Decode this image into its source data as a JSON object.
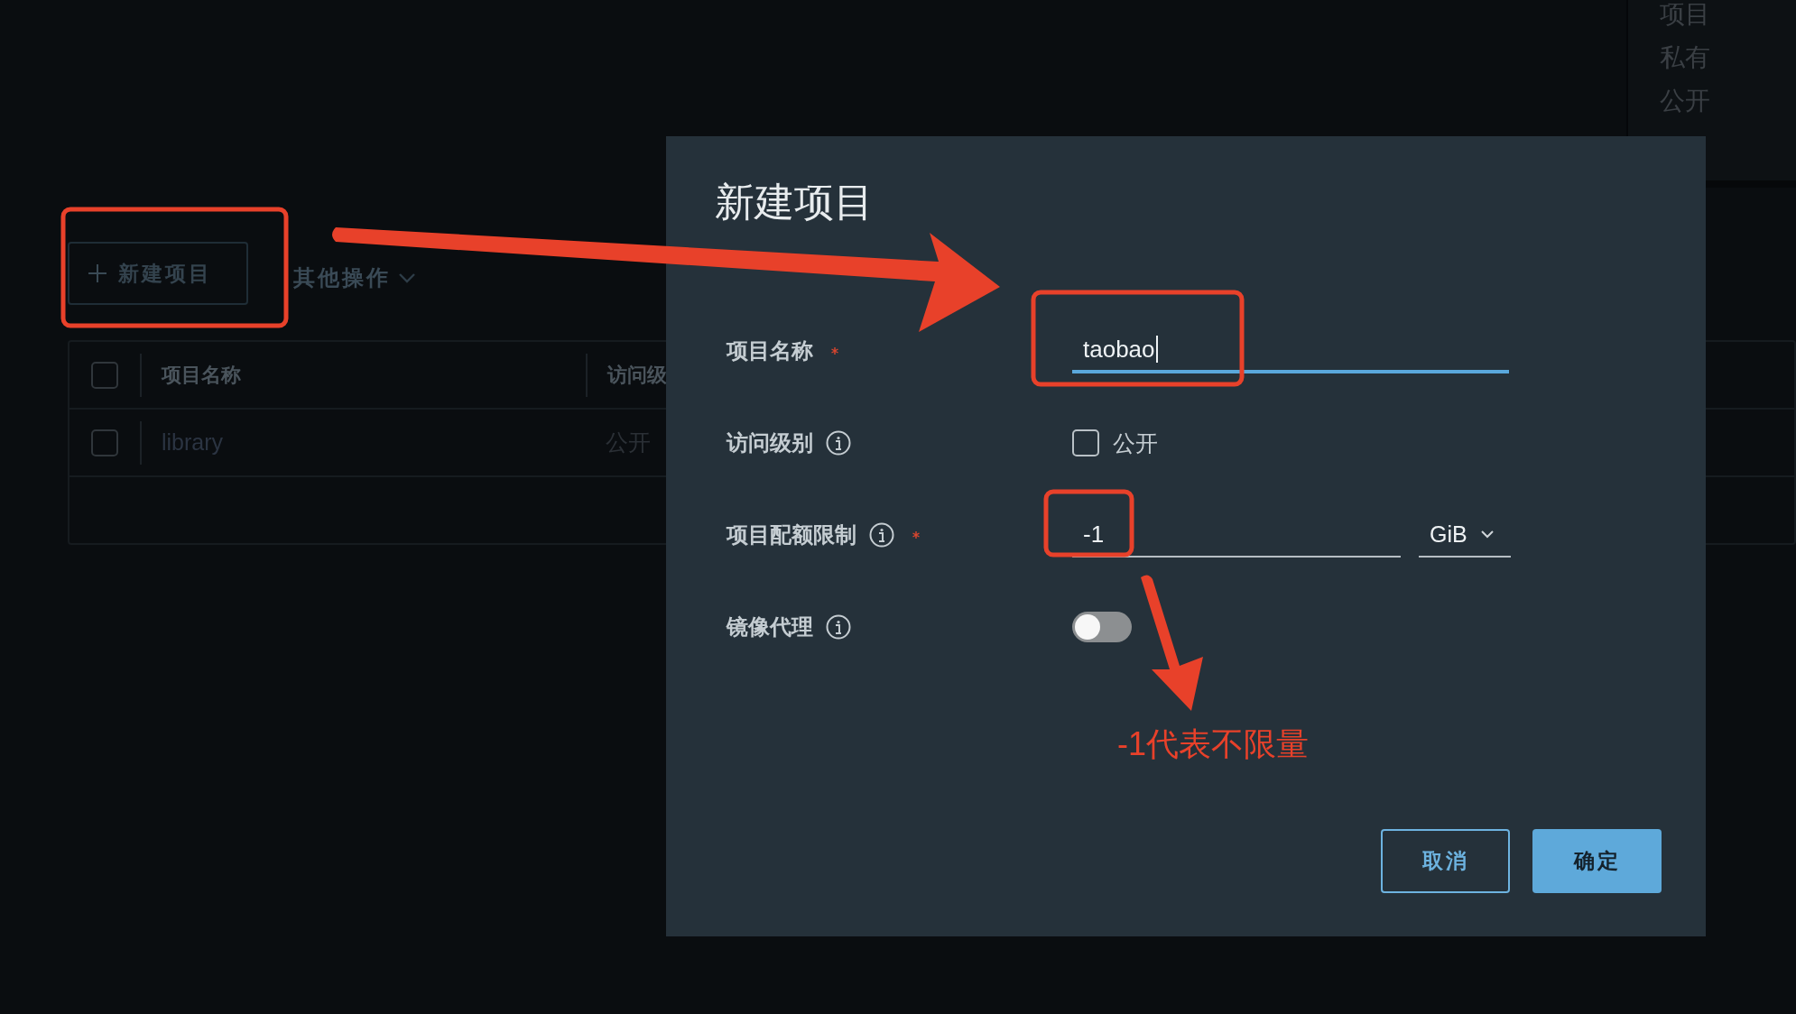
{
  "background": {
    "toolbar": {
      "new_button": "新建项目",
      "more_actions": "其他操作"
    },
    "table": {
      "header_checked": false,
      "columns": [
        "项目名称",
        "访问级"
      ],
      "rows": [
        {
          "name": "library",
          "access": "公开",
          "selected": false
        }
      ]
    },
    "filter_menu": {
      "items": [
        "项目",
        "私有",
        "公开"
      ]
    }
  },
  "dialog": {
    "title": "新建项目",
    "fields": [
      {
        "kind": "text",
        "label": "项目名称",
        "required": true,
        "info": false,
        "value": "taobao",
        "focused": true
      },
      {
        "kind": "checkbox",
        "label": "访问级别",
        "required": false,
        "info": true,
        "option": "公开",
        "checked": false
      },
      {
        "kind": "quota",
        "label": "项目配额限制",
        "required": true,
        "info": true,
        "value": "-1",
        "unit": "GiB",
        "focused": false
      },
      {
        "kind": "toggle",
        "label": "镜像代理",
        "required": false,
        "info": true,
        "on": false
      }
    ],
    "buttons": [
      {
        "label": "取消",
        "kind": "secondary"
      },
      {
        "label": "确定",
        "kind": "primary"
      }
    ]
  },
  "annotations": {
    "note": "-1代表不限量"
  }
}
